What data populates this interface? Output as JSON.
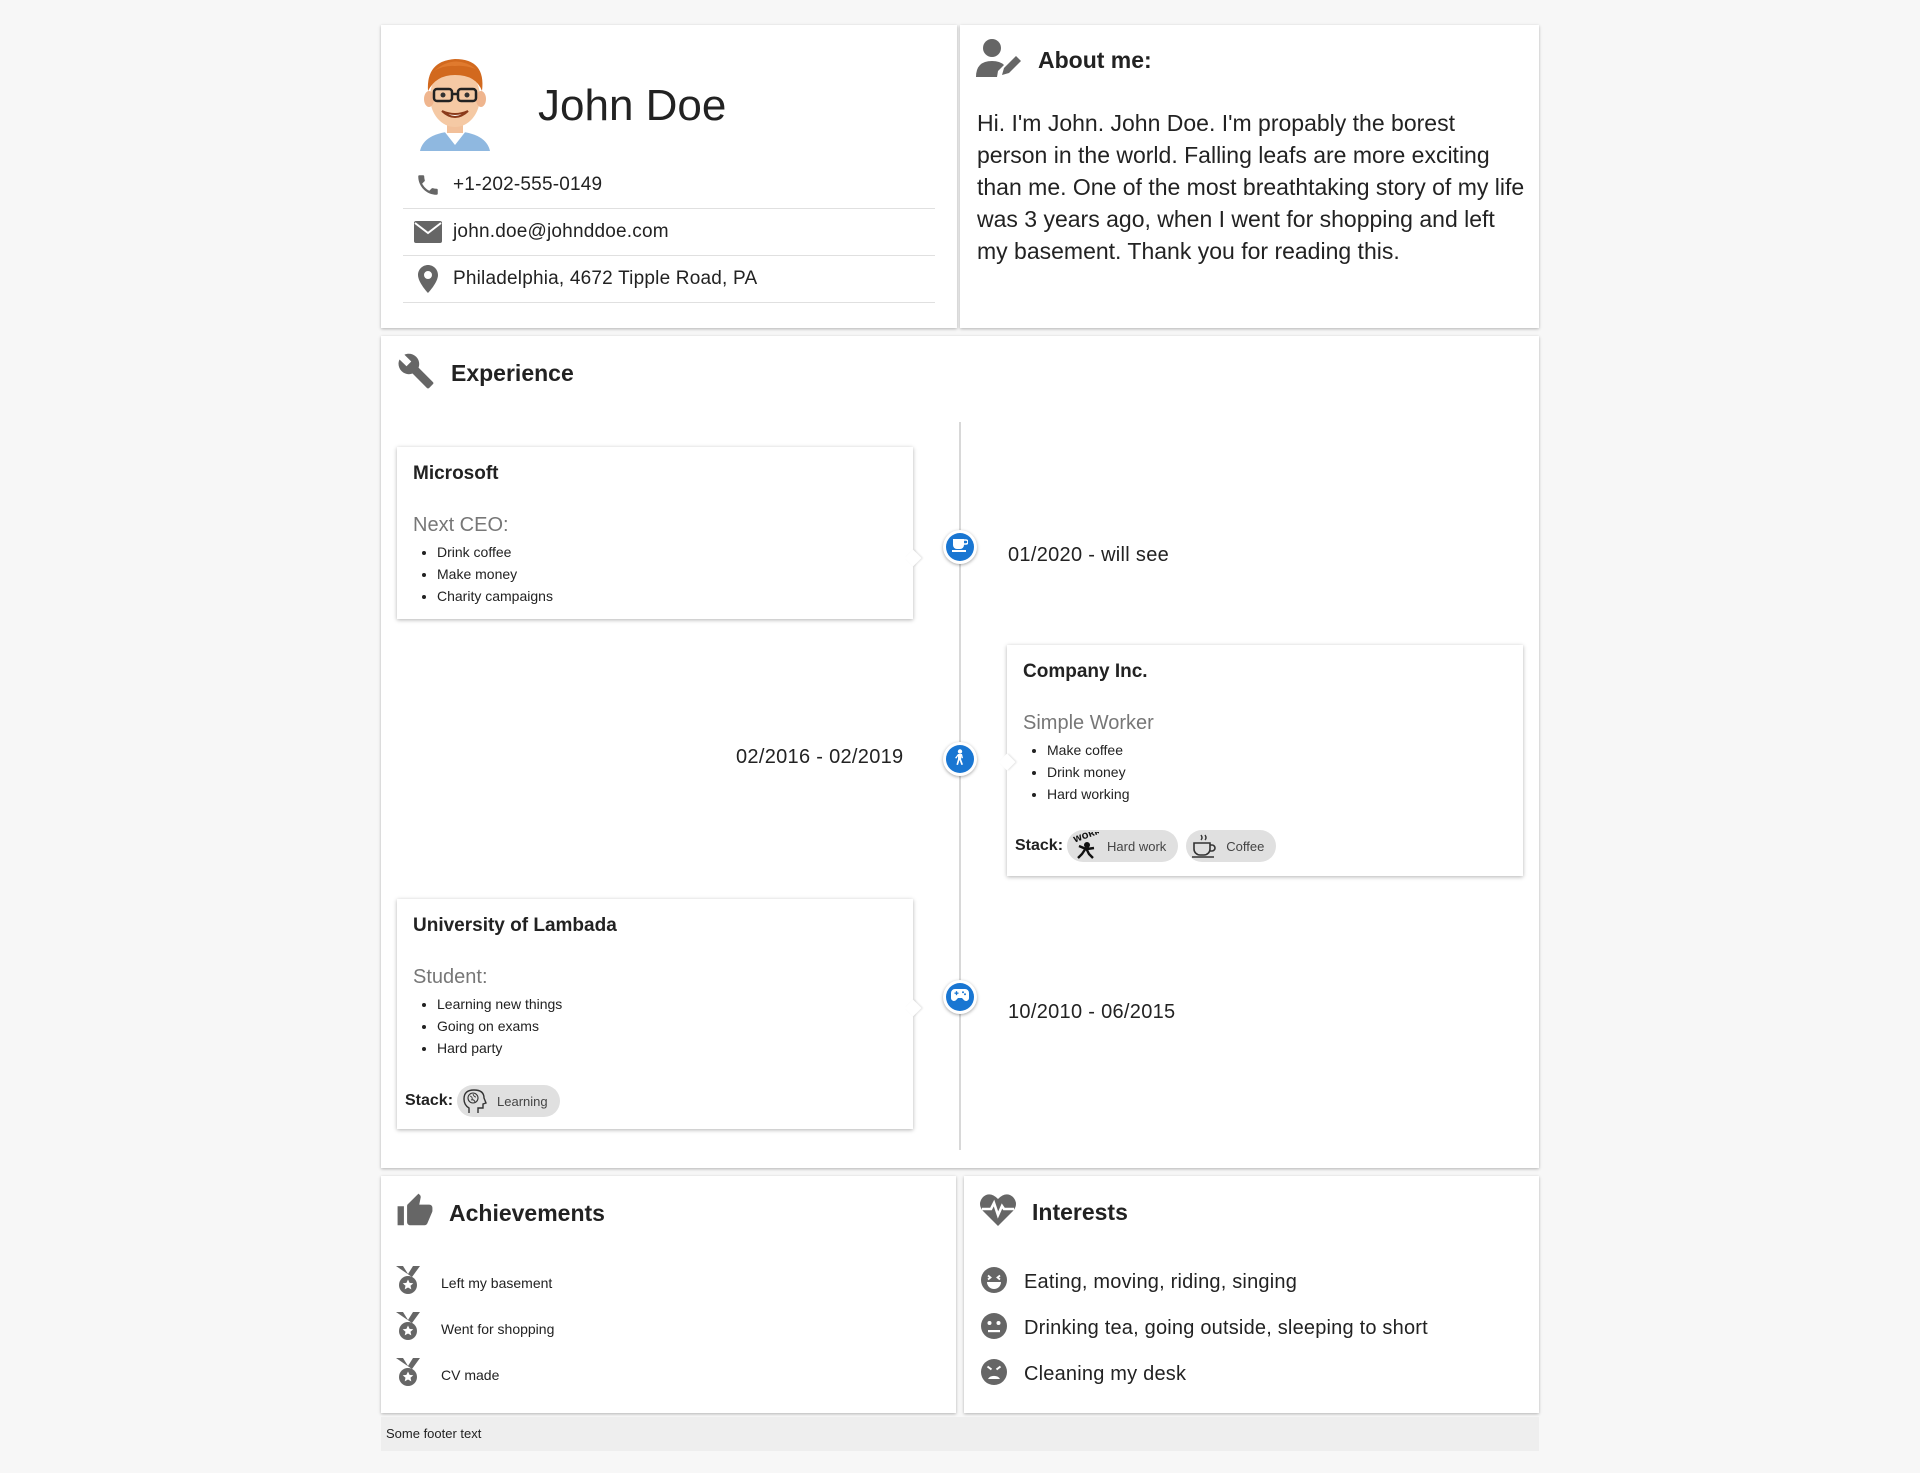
{
  "header": {
    "name": "John Doe",
    "contacts": [
      {
        "icon": "phone-icon",
        "text": "+1-202-555-0149"
      },
      {
        "icon": "envelope-icon",
        "text": "john.doe@johnddoe.com"
      },
      {
        "icon": "map-pin-icon",
        "text": "Philadelphia, 4672 Tipple Road, PA"
      }
    ]
  },
  "about": {
    "title": "About me:",
    "text": "Hi. I'm John. John Doe. I'm propably the borest person in the world. Falling leafs are more exciting than me. One of the most breathtaking story of my life was 3 years ago, when I went for shopping and left my basement. Thank you for reading this."
  },
  "experience": {
    "title": "Experience",
    "entries": [
      {
        "company": "Microsoft",
        "role": "Next CEO:",
        "duties": [
          "Drink coffee",
          "Make money",
          "Charity campaigns"
        ],
        "date": "01/2020 - will see",
        "icon": "coffee-cup-icon"
      },
      {
        "company": "Company Inc.",
        "role": "Simple Worker",
        "duties": [
          "Make coffee",
          "Drink money",
          "Hard working"
        ],
        "date": "02/2016 - 02/2019",
        "icon": "walking-person-icon",
        "stack_label": "Stack:",
        "stack": [
          "Hard work",
          "Coffee"
        ]
      },
      {
        "company": "University of Lambada",
        "role": "Student:",
        "duties": [
          "Learning new things",
          "Going on exams",
          "Hard party"
        ],
        "date": "10/2010 - 06/2015",
        "icon": "gamepad-icon",
        "stack_label": "Stack:",
        "stack": [
          "Learning"
        ]
      }
    ]
  },
  "achievements": {
    "title": "Achievements",
    "items": [
      "Left my basement",
      "Went for shopping",
      "CV made"
    ]
  },
  "interests": {
    "title": "Interests",
    "items": [
      {
        "icon": "happy-face-icon",
        "text": "Eating, moving, riding, singing"
      },
      {
        "icon": "neutral-face-icon",
        "text": "Drinking tea, going outside, sleeping to short"
      },
      {
        "icon": "sad-face-icon",
        "text": "Cleaning my desk"
      }
    ]
  },
  "footer": {
    "text": "Some footer text"
  },
  "colors": {
    "accent": "#1976d2",
    "icon_gray": "#666666"
  }
}
